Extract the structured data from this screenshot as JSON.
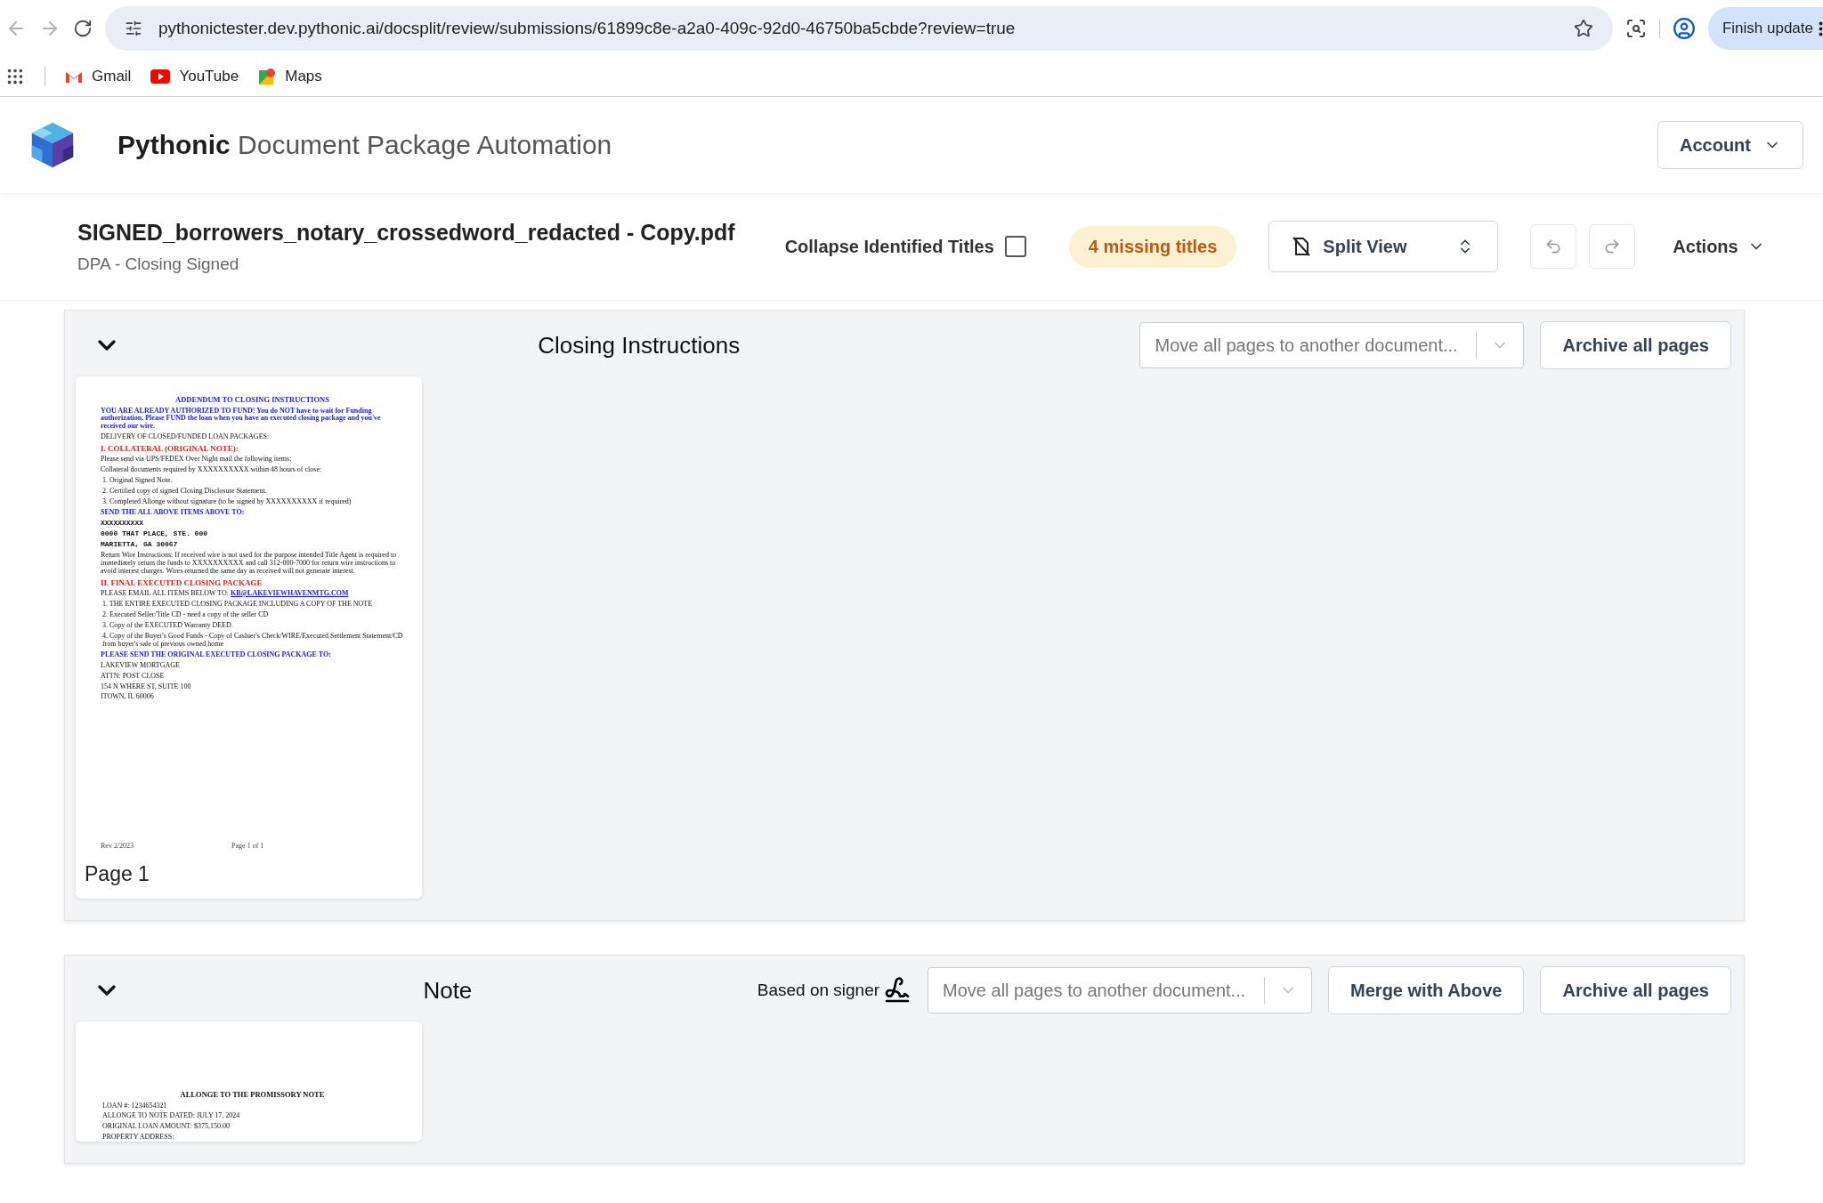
{
  "browser": {
    "url": "pythonictester.dev.pythonic.ai/docsplit/review/submissions/61899c8e-a2a0-409c-92d0-46750ba5cbde?review=true",
    "update_button": "Finish update",
    "bookmarks": [
      {
        "kind": "gmail",
        "label": "Gmail"
      },
      {
        "kind": "youtube",
        "label": "YouTube"
      },
      {
        "kind": "maps",
        "label": "Maps"
      }
    ]
  },
  "header": {
    "brand": "Pythonic",
    "product": "Document Package Automation",
    "account": "Account"
  },
  "toolbar": {
    "filename": "SIGNED_borrowers_notary_crossedword_redacted - Copy.pdf",
    "subtitle": "DPA - Closing Signed",
    "collapse_label": "Collapse Identified Titles",
    "collapse_checked": false,
    "missing": "4 missing titles",
    "view": "Split View",
    "actions": "Actions"
  },
  "documents": [
    {
      "title": "Closing Instructions",
      "expanded": true,
      "move_placeholder": "Move all pages to another document...",
      "archive": "Archive all pages",
      "pages": [
        {
          "label": "Page 1",
          "lines": [
            {
              "kind": "heading",
              "text": "ADDENDUM TO CLOSING INSTRUCTIONS"
            },
            {
              "kind": "blue",
              "text": "YOU ARE ALREADY AUTHORIZED TO FUND! You do NOT have to wait for Funding authorization. Please FUND the loan when you have an executed closing package and you've received our wire."
            },
            {
              "kind": "plain",
              "text": "DELIVERY OF CLOSED/FUNDED LOAN PACKAGES:"
            },
            {
              "kind": "red",
              "text": "I.    COLLATERAL (ORIGINAL NOTE):"
            },
            {
              "kind": "plain",
              "text": "Please send via UPS/FEDEX Over Night mail the following items:"
            },
            {
              "kind": "plain",
              "text": "Collateral documents required by XXXXXXXXXX within 48 hours of close:"
            },
            {
              "kind": "item",
              "text": "1.   Original Signed Note."
            },
            {
              "kind": "item",
              "text": "2.   Certified copy of signed Closing Disclosure Statement."
            },
            {
              "kind": "item",
              "text": "3.   Completed Allonge without signature (to be signed by XXXXXXXXXX if required)"
            },
            {
              "kind": "blue",
              "text": "SEND THE ALL ABOVE ITEMS ABOVE TO:"
            },
            {
              "kind": "mono",
              "text": "XXXXXXXXXX"
            },
            {
              "kind": "mono",
              "text": "0000 THAT PLACE, STE. 000"
            },
            {
              "kind": "mono",
              "text": "MARIETTA, GA 30067"
            },
            {
              "kind": "plain",
              "text": "Return Wire Instructions: If received wire is not used for the purpose intended Title Agent is required to immediately return the funds to XXXXXXXXXX and call 312-000-7000 for return wire instructions to avoid interest charges. Wires returned the same day as received will not generate interest."
            },
            {
              "kind": "red",
              "text": "II.   FINAL EXECUTED CLOSING PACKAGE"
            },
            {
              "kind": "plain",
              "text": "PLEASE EMAIL ALL ITEMS BELOW TO:",
              "link": "KB@LAKEVIEWHAVENMTG.COM"
            },
            {
              "kind": "item",
              "text": "1.   THE ENTIRE EXECUTED CLOSING PACKAGE INCLUDING A COPY OF THE NOTE"
            },
            {
              "kind": "item",
              "text": "2.   Executed Seller/Title CD - need a copy of the seller CD"
            },
            {
              "kind": "item",
              "text": "3.   Copy of the EXECUTED Warranty DEED."
            },
            {
              "kind": "item",
              "text": "4.   Copy of the Buyer's Good Funds - Copy of Cashier's Check/WIRE/Executed Settlement Statement/CD from buyer's sale of previous owned home"
            },
            {
              "kind": "blue",
              "text": "PLEASE SEND THE ORIGINAL EXECUTED CLOSING PACKAGE TO:"
            },
            {
              "kind": "plain",
              "text": "LAKEVIEW MORTGAGE"
            },
            {
              "kind": "plain",
              "text": "ATTN: POST CLOSE"
            },
            {
              "kind": "plain",
              "text": "154 N WHERE ST, SUITE 100"
            },
            {
              "kind": "plain",
              "text": "ITOWN, IL 60006"
            }
          ],
          "footer": [
            "Rev 2/2023",
            "Page 1 of 1"
          ]
        }
      ]
    },
    {
      "title": "Note",
      "expanded": true,
      "signer": "Based on signer",
      "move_placeholder": "Move all pages to another document...",
      "merge": "Merge with Above",
      "archive": "Archive all pages",
      "pages": [
        {
          "lines": [
            {
              "kind": "heading-black",
              "text": "ALLONGE TO THE PROMISSORY NOTE"
            },
            {
              "kind": "plain",
              "text": "LOAN #: 1234654321"
            },
            {
              "kind": "plain",
              "text": "ALLONGE TO NOTE DATED: JULY 17, 2024"
            },
            {
              "kind": "plain",
              "text": "ORIGINAL LOAN AMOUNT: $375,150.00"
            },
            {
              "kind": "plain",
              "text": "PROPERTY ADDRESS:"
            }
          ]
        }
      ]
    }
  ]
}
